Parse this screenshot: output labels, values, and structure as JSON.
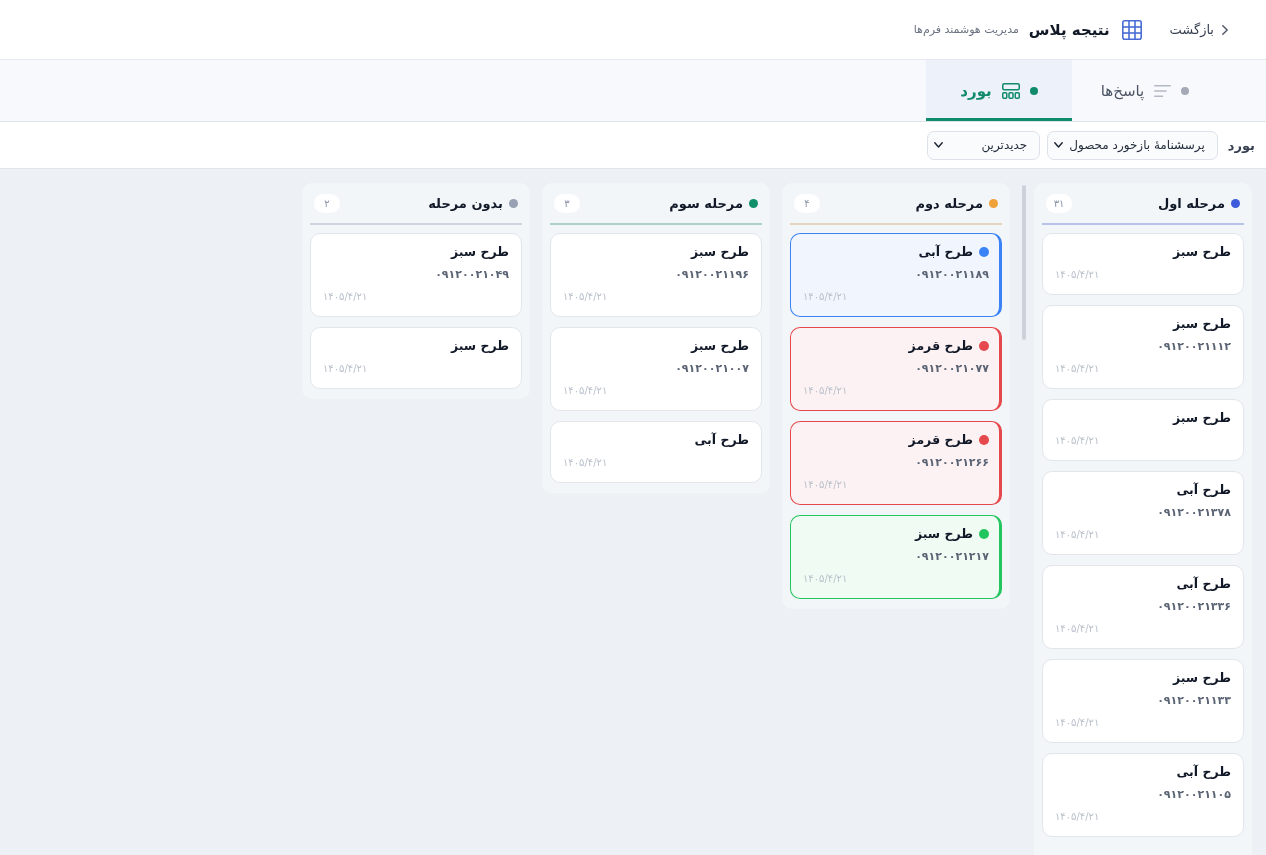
{
  "header": {
    "back": "بازگشت",
    "title": "نتیجه پلاس",
    "subtitle": "مدیریت هوشمند فرم‌ها"
  },
  "tabs": [
    {
      "label": "پاسخ‌ها",
      "kind": "list",
      "selected": false
    },
    {
      "label": "بورد",
      "kind": "board",
      "selected": true
    }
  ],
  "filters": {
    "label": "بورد",
    "form_select": {
      "value": "پرسشنامهٔ بازخورد محصول"
    },
    "sort_select": {
      "value": "جدیدترین"
    }
  },
  "columns": [
    {
      "title": "مرحله اول",
      "color": "#3b5bdb",
      "count": "۳۱",
      "scrollable": true,
      "cards": [
        {
          "title": "طرح سبز",
          "date": "۱۴۰۵/۴/۲۱"
        },
        {
          "title": "طرح سبز",
          "phone": "۰۹۱۲۰۰۲۱۱۱۲",
          "date": "۱۴۰۵/۴/۲۱"
        },
        {
          "title": "طرح سبز",
          "date": "۱۴۰۵/۴/۲۱"
        },
        {
          "title": "طرح آبی",
          "phone": "۰۹۱۲۰۰۲۱۳۷۸",
          "date": "۱۴۰۵/۴/۲۱"
        },
        {
          "title": "طرح آبی",
          "phone": "۰۹۱۲۰۰۲۱۳۳۶",
          "date": "۱۴۰۵/۴/۲۱"
        },
        {
          "title": "طرح سبز",
          "phone": "۰۹۱۲۰۰۲۱۱۳۳",
          "date": "۱۴۰۵/۴/۲۱"
        },
        {
          "title": "طرح آبی",
          "phone": "۰۹۱۲۰۰۲۱۱۰۵",
          "date": "۱۴۰۵/۴/۲۱"
        }
      ]
    },
    {
      "title": "مرحله دوم",
      "color": "#f0a23a",
      "count": "۴",
      "scrollable": false,
      "cards": [
        {
          "title": "طرح آبی",
          "phone": "۰۹۱۲۰۰۲۱۱۸۹",
          "date": "۱۴۰۵/۴/۲۱",
          "color": "#3b82f6"
        },
        {
          "title": "طرح قرمز",
          "phone": "۰۹۱۲۰۰۲۱۰۷۷",
          "date": "۱۴۰۵/۴/۲۱",
          "color": "#e5484d"
        },
        {
          "title": "طرح قرمز",
          "phone": "۰۹۱۲۰۰۲۱۲۶۶",
          "date": "۱۴۰۵/۴/۲۱",
          "color": "#e5484d"
        },
        {
          "title": "طرح سبز",
          "phone": "۰۹۱۲۰۰۲۱۲۱۷",
          "date": "۱۴۰۵/۴/۲۱",
          "color": "#22c55e"
        }
      ]
    },
    {
      "title": "مرحله سوم",
      "color": "#0f8f6a",
      "count": "۳",
      "scrollable": false,
      "cards": [
        {
          "title": "طرح سبز",
          "phone": "۰۹۱۲۰۰۲۱۱۹۶",
          "date": "۱۴۰۵/۴/۲۱"
        },
        {
          "title": "طرح سبز",
          "phone": "۰۹۱۲۰۰۲۱۰۰۷",
          "date": "۱۴۰۵/۴/۲۱"
        },
        {
          "title": "طرح آبی",
          "date": "۱۴۰۵/۴/۲۱"
        }
      ]
    },
    {
      "title": "بدون مرحله",
      "color": "#97a1b3",
      "count": "۲",
      "scrollable": false,
      "cards": [
        {
          "title": "طرح سبز",
          "phone": "۰۹۱۲۰۰۲۱۰۴۹",
          "date": "۱۴۰۵/۴/۲۱"
        },
        {
          "title": "طرح سبز",
          "date": "۱۴۰۵/۴/۲۱"
        }
      ]
    }
  ]
}
